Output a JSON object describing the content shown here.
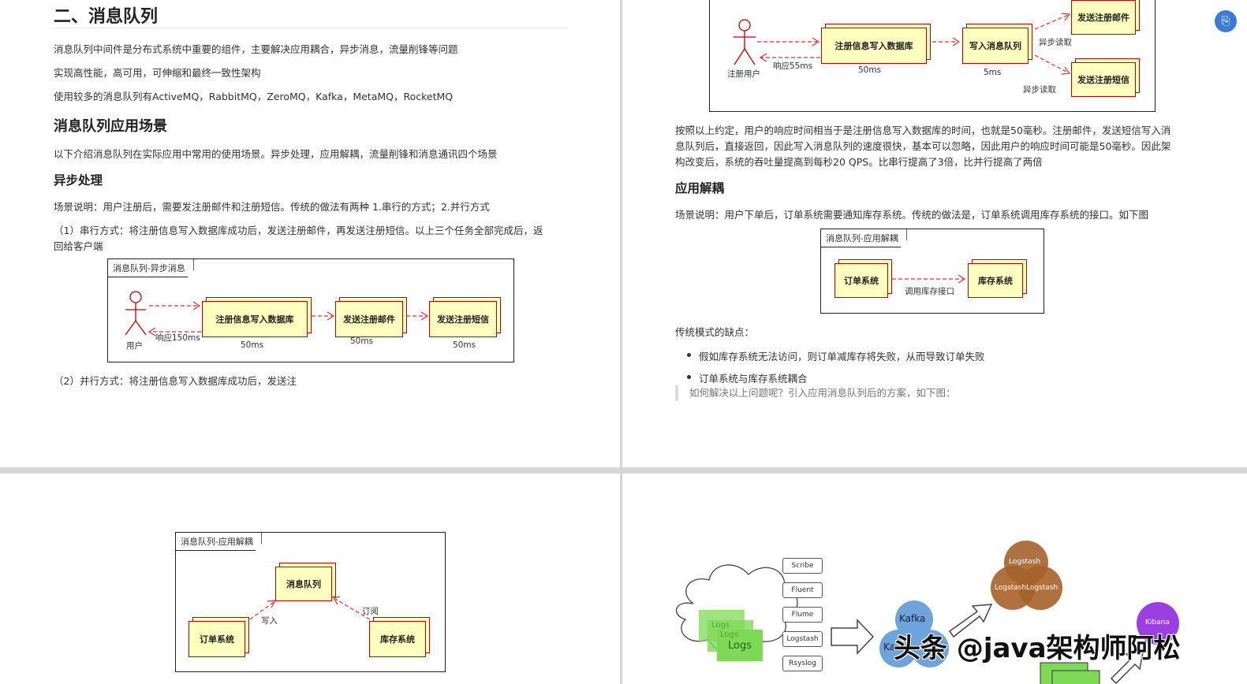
{
  "page1": {
    "h2": "二、消息队列",
    "p1": "消息队列中间件是分布式系统中重要的组件，主要解决应用耦合，异步消息，流量削锋等问题",
    "p2": "实现高性能，高可用，可伸缩和最终一致性架构",
    "p3": "使用较多的消息队列有ActiveMQ，RabbitMQ，ZeroMQ，Kafka，MetaMQ，RocketMQ",
    "h3": "消息队列应用场景",
    "p4": "以下介绍消息队列在实际应用中常用的使用场景。异步处理，应用解耦，流量削锋和消息通讯四个场景",
    "h4": "异步处理",
    "p5": "场景说明：用户注册后，需要发注册邮件和注册短信。传统的做法有两种 1.串行的方式；2.并行方式",
    "p6a": "（1）串行方式：将注册信息写入数据库成功后，发送注册邮件，再发送注册短信。以上三个任务全部完成后，返",
    "p6b": "回给客户端",
    "diagram": {
      "tab": "消息队列-异步消息",
      "actor": "用户",
      "box1": "注册信息写入数据库",
      "box2": "发送注册邮件",
      "box3": "发送注册短信",
      "resp": "响应150ms",
      "t1": "50ms",
      "t2": "50ms",
      "t3": "50ms"
    },
    "p7": "（2）并行方式：将注册信息写入数据库成功后，发送注"
  },
  "page2": {
    "diagram": {
      "actor": "注册用户",
      "box1": "注册信息写入数据库",
      "box2": "写入消息队列",
      "box3": "发送注册邮件",
      "box4": "发送注册短信",
      "resp": "响应55ms",
      "t1": "50ms",
      "t2": "5ms",
      "async1": "异步读取",
      "async2": "异步读取"
    },
    "p1a": "按照以上约定，用户的响应时间相当于是注册信息写入数据库的时间，也就是50毫秒。注册邮件，发送短信写入消",
    "p1b": "息队列后，直接返回，因此写入消息队列的速度很快，基本可以忽略，因此用户的响应时间可能是50毫秒。因此架",
    "p1c": "构改变后，系统的吞吐量提高到每秒20 QPS。比串行提高了3倍，比并行提高了两倍",
    "h4": "应用解耦",
    "p2": "场景说明：用户下单后，订单系统需要通知库存系统。传统的做法是，订单系统调用库存系统的接口。如下图",
    "diagram2": {
      "tab": "消息队列-应用解耦",
      "box1": "订单系统",
      "box2": "库存系统",
      "call": "调用库存接口"
    },
    "p3": "传统模式的缺点：",
    "bullets": [
      "假如库存系统无法访问，则订单减库存将失败，从而导致订单失败",
      "订单系统与库存系统耦合"
    ],
    "quote": "如何解决以上问题呢？引入应用消息队列后的方案，如下图："
  },
  "page3": {
    "diagram": {
      "tab": "消息队列-应用解耦",
      "mq": "消息队列",
      "order": "订单系统",
      "stock": "库存系统",
      "write": "写入",
      "sub": "订阅"
    }
  },
  "page4": {
    "sources": [
      "Scribe",
      "Fluent",
      "Flume",
      "Logstash",
      "Rsyslog"
    ],
    "logs": [
      "Logs",
      "Logs",
      "Logs"
    ],
    "kafka": [
      "Kafka",
      "Ka"
    ],
    "logstash": [
      "Logstash",
      "Logstash",
      "Logstash"
    ],
    "kibana": "Kibana"
  },
  "watermark": "头条 @java架构师阿松",
  "colors": {
    "box_fill": "#ffffc0",
    "box_border": "#b00000",
    "arrow": "#e03030",
    "kafka": "#6ea3dc",
    "logstash": "#a5622a",
    "kibana": "#9b3fe0",
    "logs": "#7ed957"
  }
}
